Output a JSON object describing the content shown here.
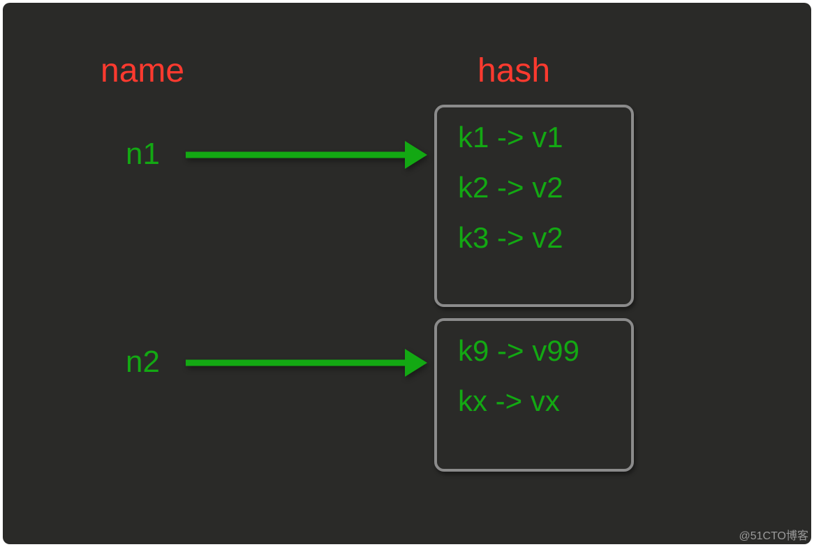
{
  "headers": {
    "name": "name",
    "hash": "hash"
  },
  "names": {
    "n1": "n1",
    "n2": "n2"
  },
  "hash_boxes": {
    "box1": {
      "e1": "k1 -> v1",
      "e2": "k2 -> v2",
      "e3": "k3 -> v2"
    },
    "box2": {
      "e1": "k9 -> v99",
      "e2": "kx -> vx"
    }
  },
  "colors": {
    "background": "#2a2a28",
    "header_text": "#ff3a2f",
    "value_text": "#13a813",
    "arrow": "#13a813",
    "box_border": "#8b8b8b"
  },
  "watermark": "@51CTO博客"
}
